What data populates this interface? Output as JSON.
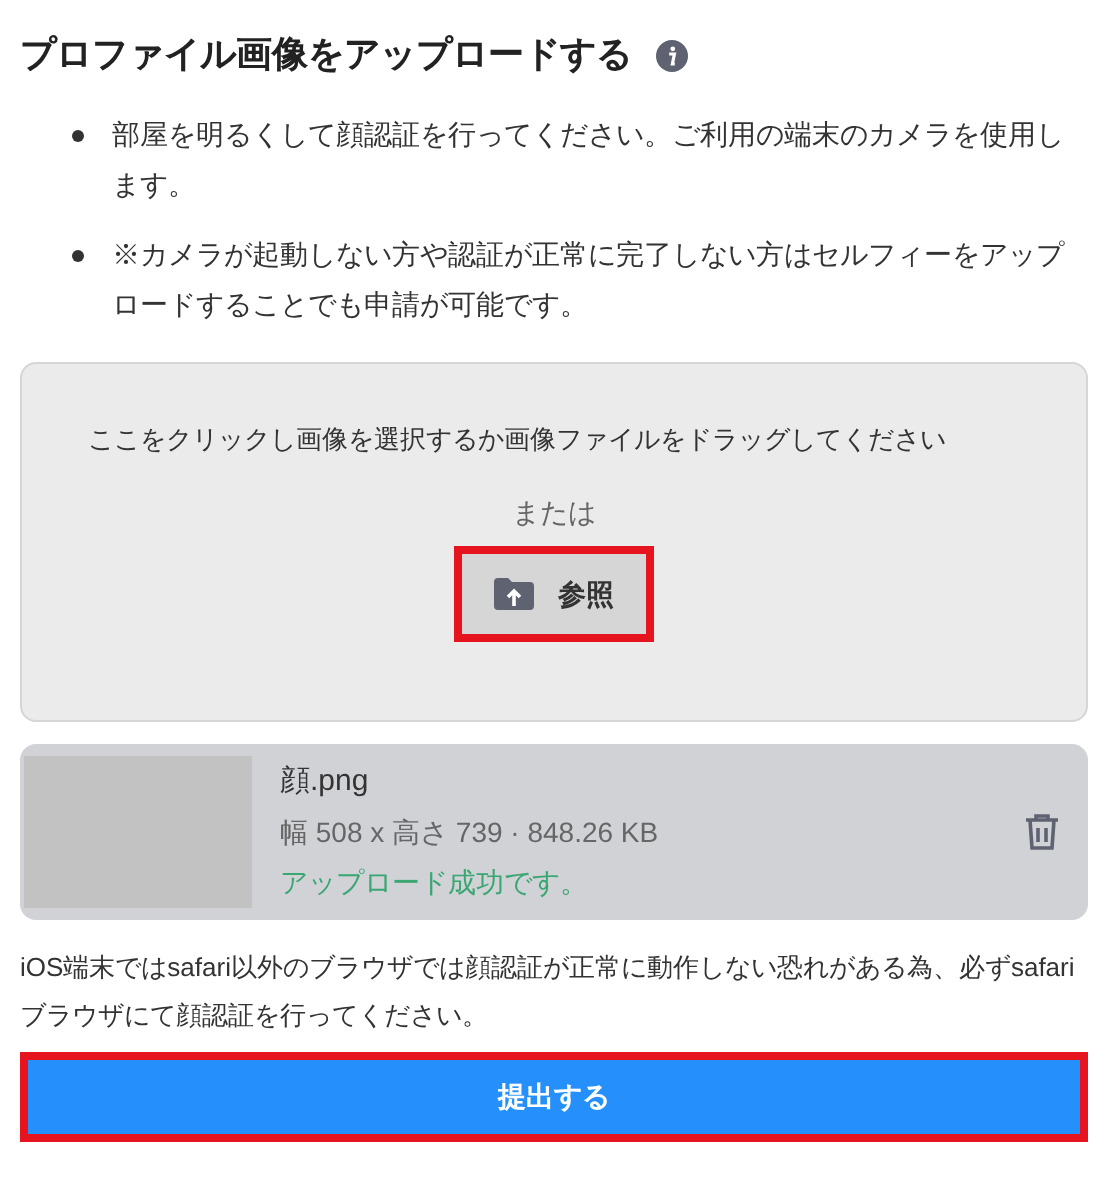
{
  "title": "プロファイル画像をアップロードする",
  "bullets": [
    "部屋を明るくして顔認証を行ってください。ご利用の端末のカメラを使用します。",
    "※カメラが起動しない方や認証が正常に完了しない方はセルフィーをアップロードすることでも申請が可能です。"
  ],
  "dropzone": {
    "instruction": "ここをクリックし画像を選択するか画像ファイルをドラッグしてください",
    "or": "または",
    "browse_button": "参照",
    "highlighted": true
  },
  "file": {
    "name": "顔.png",
    "details": "幅 508 x 高さ 739 · 848.26 KB",
    "status": "アップロード成功です。"
  },
  "note": "iOS端末ではsafari以外のブラウザでは顔認証が正常に動作しない恐れがある為、必ずsafariブラウザにて顔認証を行ってください。",
  "submit": {
    "label": "提出する",
    "highlighted": true
  }
}
